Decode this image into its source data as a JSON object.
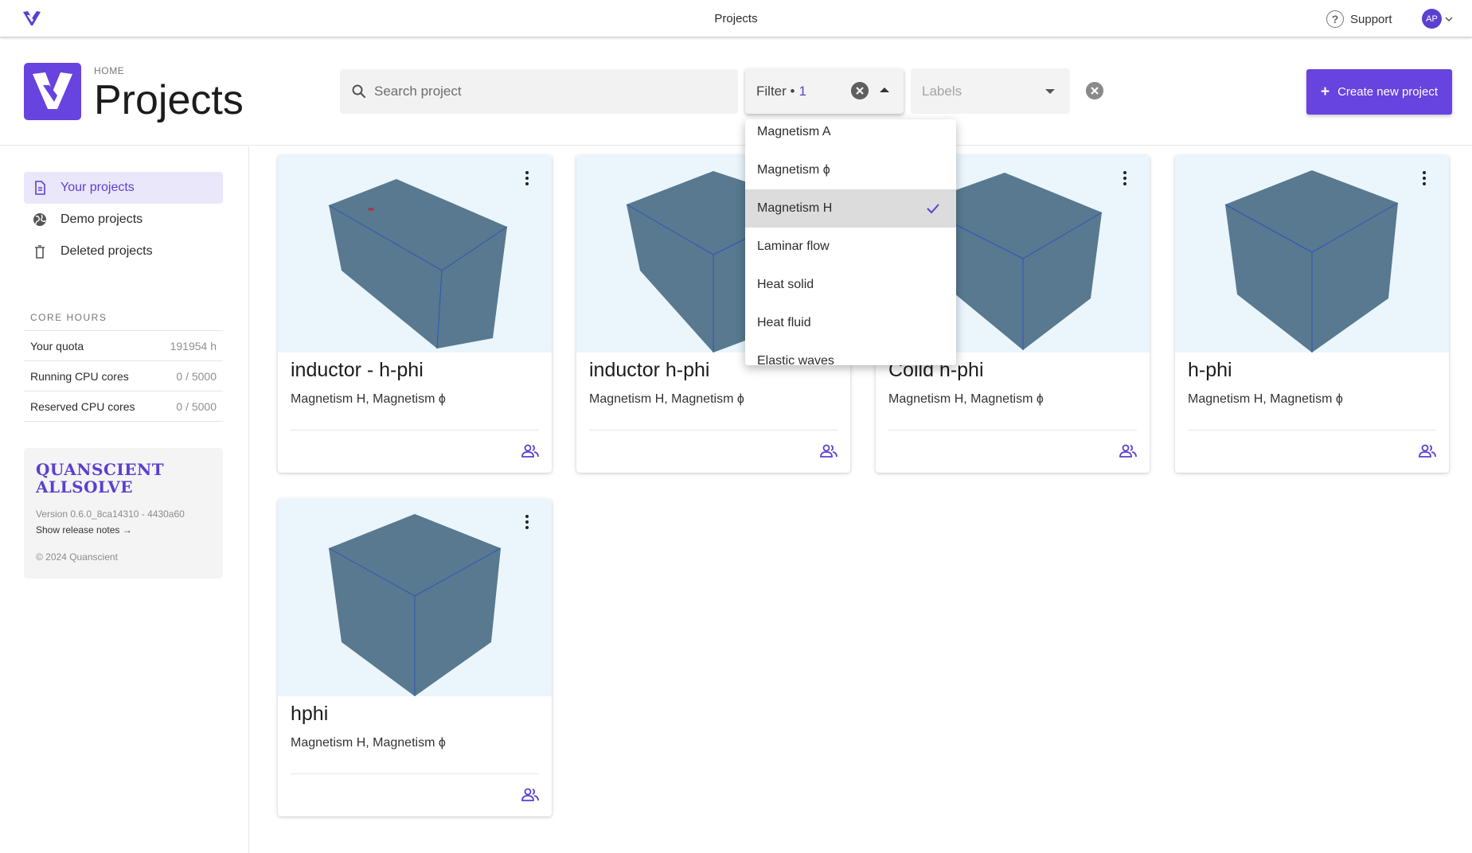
{
  "topbar": {
    "title": "Projects",
    "support_label": "Support",
    "support_icon": "help-circle-icon",
    "avatar_initials": "AP"
  },
  "header": {
    "breadcrumb": "HOME",
    "title": "Projects",
    "search_placeholder": "Search project",
    "filter_label": "Filter •",
    "filter_count": "1",
    "labels_placeholder": "Labels",
    "create_label": "Create new project"
  },
  "sidebar": {
    "items": [
      {
        "label": "Your projects",
        "icon": "document-icon",
        "active": true
      },
      {
        "label": "Demo projects",
        "icon": "globe-icon",
        "active": false
      },
      {
        "label": "Deleted projects",
        "icon": "trash-icon",
        "active": false
      }
    ],
    "core_hours": {
      "title": "CORE HOURS",
      "rows": [
        {
          "label": "Your quota",
          "value": "191954 h"
        },
        {
          "label": "Running CPU cores",
          "value": "0 / 5000"
        },
        {
          "label": "Reserved CPU cores",
          "value": "0 / 5000"
        }
      ]
    },
    "brand": {
      "name_line1": "QUANSCIENT",
      "name_line2": "ALLSOLVE",
      "version": "Version 0.6.0_8ca14310 - 4430a60",
      "release_notes": "Show release notes →",
      "copyright": "© 2024 Quanscient"
    }
  },
  "projects": [
    {
      "name": "inductor - h-phi",
      "tags": "Magnetism H, Magnetism ϕ"
    },
    {
      "name": "inductor h-phi",
      "tags": "Magnetism H, Magnetism ϕ"
    },
    {
      "name": "Coild h-phi",
      "tags": "Magnetism H, Magnetism ϕ"
    },
    {
      "name": "h-phi",
      "tags": "Magnetism H, Magnetism ϕ"
    },
    {
      "name": "hphi",
      "tags": "Magnetism H, Magnetism ϕ"
    }
  ],
  "filter_dropdown": {
    "options": [
      {
        "label": "Magnetism A",
        "selected": false
      },
      {
        "label": "Magnetism ϕ",
        "selected": false
      },
      {
        "label": "Magnetism H",
        "selected": true
      },
      {
        "label": "Laminar flow",
        "selected": false
      },
      {
        "label": "Heat solid",
        "selected": false
      },
      {
        "label": "Heat fluid",
        "selected": false
      },
      {
        "label": "Elastic waves",
        "selected": false
      }
    ]
  },
  "colors": {
    "accent": "#6743e0",
    "cube_face": "#58798f",
    "cube_edge": "#2e55b8",
    "thumb_bg": "#eaf5fc"
  }
}
